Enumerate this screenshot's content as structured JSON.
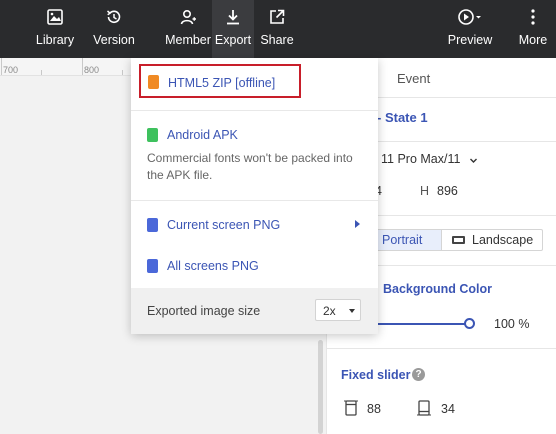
{
  "toolbar": {
    "library": "Library",
    "version": "Version",
    "member": "Member",
    "export": "Export",
    "share": "Share",
    "preview": "Preview",
    "more": "More"
  },
  "ruler": {
    "labels": [
      "700",
      "800"
    ]
  },
  "dropdown": {
    "html5": "HTML5 ZIP [offline]",
    "android": "Android APK",
    "android_note": "Commercial fonts won't be packed into the APK file.",
    "current_png": "Current screen PNG",
    "all_png": "All screens PNG",
    "footer_label": "Exported image size",
    "size_value": "2x"
  },
  "panel": {
    "tab_event": "Event",
    "state": "- State 1",
    "device": "11 Pro Max/11",
    "width_partial": "4",
    "height_label": "H",
    "height": "896",
    "portrait": "Portrait",
    "landscape": "Landscape",
    "background_color": "Background Color",
    "opacity_pct": "100 %",
    "fixed_slider": "Fixed slider",
    "fixed_top": "88",
    "fixed_bottom": "34"
  },
  "colors": {
    "toolbar_bg": "#2a2b2d",
    "accent": "#3b55b4",
    "highlight_border": "#c81e2a"
  }
}
